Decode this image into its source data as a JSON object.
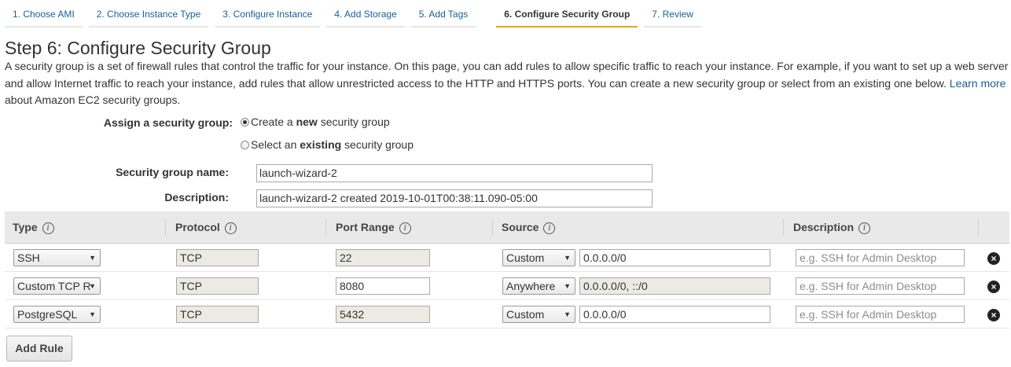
{
  "wizard_tabs": [
    {
      "label": "1. Choose AMI"
    },
    {
      "label": "2. Choose Instance Type"
    },
    {
      "label": "3. Configure Instance"
    },
    {
      "label": "4. Add Storage"
    },
    {
      "label": "5. Add Tags"
    },
    {
      "label": "6. Configure Security Group",
      "active": true
    },
    {
      "label": "7. Review"
    }
  ],
  "page_title": "Step 6: Configure Security Group",
  "intro": {
    "text": "A security group is a set of firewall rules that control the traffic for your instance. On this page, you can add rules to allow specific traffic to reach your instance. For example, if you want to set up a web server and allow Internet traffic to reach your instance, add rules that allow unrestricted access to the HTTP and HTTPS ports. You can create a new security group or select from an existing one below.",
    "link_text": "Learn more",
    "trailing_text": "about Amazon EC2 security groups."
  },
  "assign": {
    "label": "Assign a security group:",
    "option_new": {
      "prefix": "Create a ",
      "bold": "new",
      "suffix": " security group",
      "checked": true
    },
    "option_existing": {
      "prefix": "Select an ",
      "bold": "existing",
      "suffix": " security group",
      "checked": false
    }
  },
  "group_name": {
    "label": "Security group name:",
    "value": "launch-wizard-2"
  },
  "description": {
    "label": "Description:",
    "value": "launch-wizard-2 created 2019-10-01T00:38:11.090-05:00"
  },
  "table": {
    "headers": {
      "type": "Type",
      "protocol": "Protocol",
      "port_range": "Port Range",
      "source": "Source",
      "description": "Description"
    },
    "info_glyph": "i",
    "rows": [
      {
        "type": "SSH",
        "protocol": "TCP",
        "port_range": "22",
        "source_mode": "Custom",
        "source_value": "0.0.0.0/0",
        "description_placeholder": "e.g. SSH for Admin Desktop"
      },
      {
        "type": "Custom TCP R",
        "protocol": "TCP",
        "port_range": "8080",
        "source_mode": "Anywhere",
        "source_value": "0.0.0.0/0, ::/0",
        "description_placeholder": "e.g. SSH for Admin Desktop"
      },
      {
        "type": "PostgreSQL",
        "protocol": "TCP",
        "port_range": "5432",
        "source_mode": "Custom",
        "source_value": "0.0.0.0/0",
        "description_placeholder": "e.g. SSH for Admin Desktop"
      }
    ]
  },
  "add_rule_label": "Add Rule",
  "colors": {
    "link": "#1a5e97",
    "active_tab_underline": "#e8a317"
  },
  "icons": {
    "info": "info-icon",
    "delete": "delete-rule-icon",
    "dropdown": "chevron-down-icon"
  }
}
